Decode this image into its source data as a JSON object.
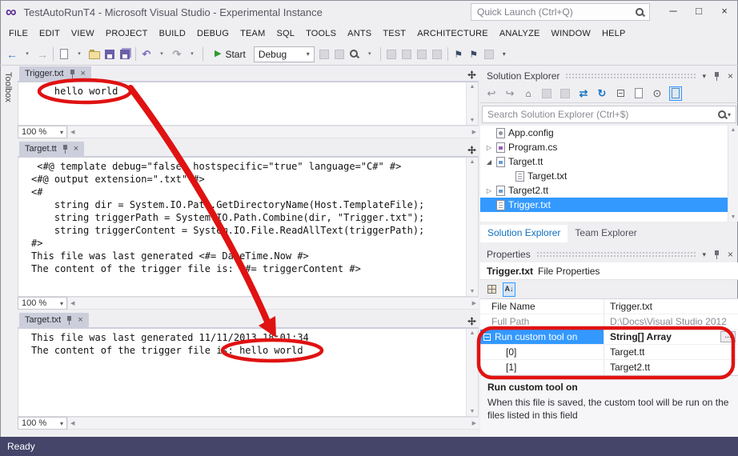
{
  "title_bar": {
    "app_title": "TestAutoRunT4 - Microsoft Visual Studio - Experimental Instance",
    "quick_launch_placeholder": "Quick Launch (Ctrl+Q)",
    "logo_glyph": "∞"
  },
  "icons": {
    "minimize": "─",
    "maximize": "□",
    "close": "×",
    "caret_down": "▾",
    "play": "▶",
    "up": "▲",
    "down": "▼",
    "left": "◀",
    "right": "▶",
    "dots": "..."
  },
  "menu": {
    "items": [
      "FILE",
      "EDIT",
      "VIEW",
      "PROJECT",
      "BUILD",
      "DEBUG",
      "TEAM",
      "SQL",
      "TOOLS",
      "ANTS",
      "TEST",
      "ARCHITECTURE",
      "ANALYZE",
      "WINDOW",
      "HELP"
    ]
  },
  "toolbar": {
    "start_label": "Start",
    "debug_value": "Debug",
    "group_nav": [
      {
        "name": "nav-back-icon",
        "glyph": "←",
        "style": "color:#3579BE;font-weight:bold;font-size:14px"
      },
      {
        "name": "nav-back-caret-icon",
        "glyph": "▾",
        "style": "font-size:7px;color:#666"
      },
      {
        "name": "nav-forward-icon",
        "glyph": "→",
        "style": "color:#ABABB5;font-weight:bold;font-size:14px"
      }
    ],
    "group_file": [
      {
        "name": "new-file-icon",
        "kind": "page"
      },
      {
        "name": "new-file-caret-icon",
        "glyph": "▾",
        "style": "font-size:7px;color:#666"
      },
      {
        "name": "open-file-icon",
        "kind": "folder"
      },
      {
        "name": "save-icon",
        "kind": "floppy"
      },
      {
        "name": "save-all-icon",
        "kind": "floppy2"
      }
    ],
    "group_undo": [
      {
        "name": "undo-icon",
        "glyph": "↶",
        "style": "color:#7A6FC0;font-weight:bold"
      },
      {
        "name": "undo-caret-icon",
        "glyph": "▾",
        "style": "font-size:7px;color:#666"
      },
      {
        "name": "redo-icon",
        "glyph": "↷",
        "style": "color:#A0A5AC;font-weight:bold"
      },
      {
        "name": "redo-caret-icon",
        "glyph": "▾",
        "style": "font-size:7px;color:#666"
      }
    ],
    "group_debug_tools": [
      {
        "name": "attach-to-process-icon",
        "kind": "gray"
      },
      {
        "name": "breakpoints-icon",
        "kind": "gray"
      },
      {
        "name": "find-icon",
        "kind": "mag"
      },
      {
        "name": "find-caret-icon",
        "glyph": "▾",
        "style": "font-size:7px;color:#666"
      }
    ],
    "group_edit_tools": [
      {
        "name": "navigate-backward-icon",
        "kind": "gray"
      },
      {
        "name": "navigate-forward-icon",
        "kind": "gray"
      },
      {
        "name": "indent-icon",
        "kind": "gray"
      },
      {
        "name": "outdent-icon",
        "kind": "gray"
      }
    ],
    "group_bookmarks": [
      {
        "name": "bookmark-icon",
        "glyph": "⚑",
        "style": "color:#3A4A66;font-size:12px"
      },
      {
        "name": "next-bookmark-icon",
        "glyph": "⚑",
        "style": "color:#3A4A66;font-size:12px"
      },
      {
        "name": "previous-bookmark-icon",
        "kind": "gray"
      },
      {
        "name": "toolbar-overflow-icon",
        "glyph": "▾",
        "style": "font-size:8px;color:#555"
      }
    ]
  },
  "toolbox_label": "Toolbox",
  "panes": [
    {
      "tab": "Trigger.txt",
      "zoom": "100 %",
      "content": "    hello world"
    },
    {
      "tab": "Target.tt",
      "zoom": "100 %",
      "content": " <#@ template debug=\"false\" hostspecific=\"true\" language=\"C#\" #>\n<#@ output extension=\".txt\" #>\n<#\n    string dir = System.IO.Path.GetDirectoryName(Host.TemplateFile);\n    string triggerPath = System.IO.Path.Combine(dir, \"Trigger.txt\");\n    string triggerContent = System.IO.File.ReadAllText(triggerPath);\n#>\nThis file was last generated <#= DateTime.Now #>\nThe content of the trigger file is: <#= triggerContent #>"
    },
    {
      "tab": "Target.txt",
      "zoom": "100 %",
      "content": "This file was last generated 11/11/2013 18:01:34\nThe content of the trigger file is: hello world"
    }
  ],
  "solution_explorer": {
    "title": "Solution Explorer",
    "search_placeholder": "Search Solution Explorer (Ctrl+$)",
    "toolbar": [
      {
        "name": "back-icon",
        "glyph": "↩",
        "style": "color:#8A8A94"
      },
      {
        "name": "forward-icon",
        "glyph": "↪",
        "style": "color:#8A8A94"
      },
      {
        "name": "home-icon",
        "glyph": "⌂",
        "style": "color:#444;font-size:12px"
      },
      {
        "name": "switch-views-icon",
        "kind": "gray"
      },
      {
        "name": "pending-changes-filter-icon",
        "kind": "gray"
      },
      {
        "name": "sync-with-active-document-icon",
        "glyph": "⇄",
        "style": "color:#1C76C4;font-weight:bold"
      },
      {
        "name": "refresh-icon",
        "glyph": "↻",
        "style": "color:#1C76C4;font-weight:bold"
      },
      {
        "name": "collapse-all-icon",
        "kind": "collapse"
      },
      {
        "name": "show-all-files-icon",
        "kind": "page"
      },
      {
        "name": "properties-icon",
        "glyph": "⊙",
        "style": "color:#555"
      },
      {
        "name": "preview-selected-items-icon",
        "kind": "page-blue",
        "selected": true
      }
    ],
    "tree": [
      {
        "label": "App.config",
        "icon": "config",
        "expander": ""
      },
      {
        "label": "Program.cs",
        "icon": "cs",
        "expander": "▷"
      },
      {
        "label": "Target.tt",
        "icon": "tt",
        "expander": "◢"
      },
      {
        "label": "Target.txt",
        "icon": "txt",
        "expander": "",
        "child": true
      },
      {
        "label": "Target2.tt",
        "icon": "tt",
        "expander": "▷"
      },
      {
        "label": "Trigger.txt",
        "icon": "txt",
        "expander": "",
        "selected": true
      }
    ],
    "tabs": [
      {
        "label": "Solution Explorer",
        "active": true
      },
      {
        "label": "Team Explorer",
        "active": false
      }
    ]
  },
  "properties": {
    "title": "Properties",
    "object_name": "Trigger.txt",
    "object_type": "File Properties",
    "toolbar": [
      {
        "name": "categorized-icon",
        "kind": "grid"
      },
      {
        "name": "alphabetical-icon",
        "glyph": "A↓",
        "style": "font-size:9px;color:#333;font-weight:bold",
        "selected": true
      }
    ],
    "rows": [
      {
        "name": "File Name",
        "value": "Trigger.txt"
      },
      {
        "name": "Full Path",
        "value": "D:\\Docs\\Visual Studio 2012",
        "muted": true
      },
      {
        "name": "Run custom tool on",
        "value": "String[] Array",
        "selected": true,
        "has_button": true
      },
      {
        "name": "[0]",
        "value": "Target.tt",
        "child": true
      },
      {
        "name": "[1]",
        "value": "Target2.tt",
        "child": true
      }
    ],
    "description_title": "Run custom tool on",
    "description_text": "When this file is saved, the custom tool will be run on the files listed in this field"
  },
  "status_bar": {
    "ready": "Ready"
  }
}
